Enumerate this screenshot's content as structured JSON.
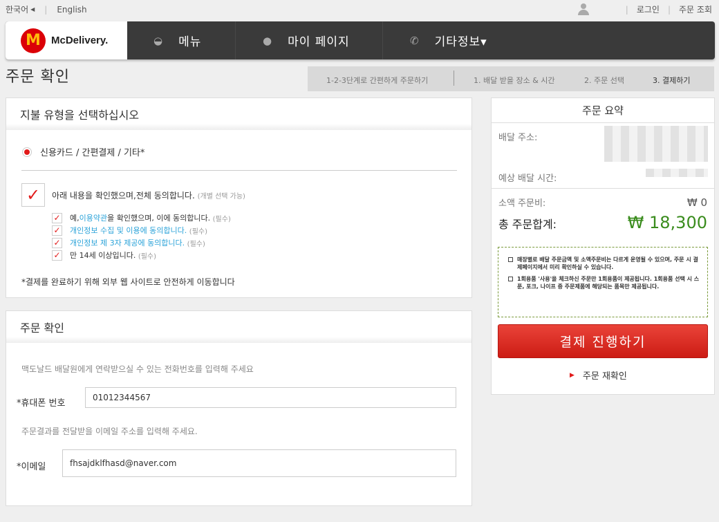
{
  "topbar": {
    "lang_korean": "한국어",
    "lang_english": "English",
    "login": "로그인",
    "order_lookup": "주문 조회"
  },
  "navbar": {
    "logo_letter": "M",
    "logo_text": "McDelivery.",
    "menu": "메뉴",
    "mypage": "마이 페이지",
    "info": "기타정보▾"
  },
  "page": {
    "title": "주문 확인",
    "steps": {
      "intro": "1-2-3단계로 간편하게 주문하기",
      "step1": "1.  배달 받을 장소 & 시간",
      "step2": "2.  주문 선택",
      "step3": "3.  결제하기"
    }
  },
  "payment": {
    "heading": "지불 유형을 선택하십시오",
    "method_label": "신용카드 / 간편결제 / 기타*",
    "agree_all": "아래 내용을 확인했으며,전체 동의합니다.",
    "agree_all_note": "(개별 선택 가능)",
    "terms": [
      {
        "pre": "예, ",
        "link": "이용약관",
        "post": "을 확인했으며, 이에 동의합니다.",
        "req": "(필수)"
      },
      {
        "pre": "",
        "link": "개인정보 수집 및 이용에 동의합니다.",
        "post": "",
        "req": "(필수)"
      },
      {
        "pre": "",
        "link": "개인정보 제 3자 제공에 동의합니다.",
        "post": "",
        "req": "(필수)"
      },
      {
        "pre": "만 14세 이상입니다.",
        "link": "",
        "post": "",
        "req": "(필수)"
      }
    ],
    "external_note": "*결제를 완료하기 위해 외부 웹 사이트로 안전하게 이동합니다"
  },
  "confirm": {
    "heading": "주문 확인",
    "phone_hint": "맥도날드 배달원에게 연락받으실 수 있는 전화번호를 입력해 주세요",
    "phone_label": "*휴대폰 번호",
    "phone_value": "01012344567",
    "email_hint": "주문결과를 전달받을 이메일 주소를 입력해 주세요.",
    "email_label": "*이메일",
    "email_value": "fhsajdklfhasd@naver.com"
  },
  "summary": {
    "title": "주문 요약",
    "address_label": "배달 주소:",
    "time_label": "예상 배달 시간:",
    "small_order_label": "소액 주문비:",
    "small_order_value": "₩ 0",
    "total_label": "총 주문합계:",
    "total_value": "₩ 18,300",
    "notices": [
      "매장별로 배달 주문금액 및 소액주문비는 다르게 운영될 수 있으며, 주문 시 결제페이지에서 미리 확인하실 수 있습니다.",
      "1회용품 '사용'을 체크하신 주문만 1회용품이 제공됩니다. 1회용품 선택 시 스푼, 포크, 나이프 중 주문제품에 해당되는 품목만 제공됩니다."
    ],
    "pay_button": "결제 진행하기",
    "recheck": "주문 재확인"
  },
  "colors": {
    "brand_red": "#db0007",
    "brand_yellow": "#ffbc0d",
    "total_green": "#3a8c1d",
    "link_blue": "#2ba3d9"
  }
}
